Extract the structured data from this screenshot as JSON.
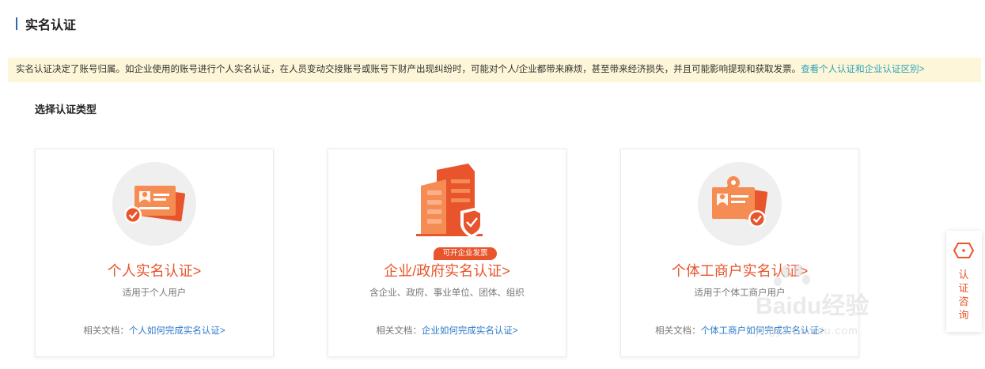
{
  "header": {
    "title": "实名认证"
  },
  "notice": {
    "text": "实名认证决定了账号归属。如企业使用的账号进行个人实名认证，在人员变动交接账号或账号下财产出现纠纷时，可能对个人/企业都带来麻烦，甚至带来经济损失，并且可能影响提现和获取发票。",
    "link": "查看个人认证和企业认证区别>"
  },
  "section": {
    "title": "选择认证类型"
  },
  "cards": [
    {
      "title": "个人实名认证>",
      "desc": "适用于个人用户",
      "doc_label": "相关文档：",
      "doc_link": "个人如何完成实名认证>",
      "icon": "id-card-icon"
    },
    {
      "title": "企业/政府实名认证>",
      "desc": "含企业、政府、事业单位、团体、组织",
      "doc_label": "相关文档：",
      "doc_link": "企业如何完成实名认证>",
      "badge": "可开企业发票",
      "icon": "building-icon"
    },
    {
      "title": "个体工商户实名认证>",
      "desc": "适用于个体工商户用户",
      "doc_label": "相关文档：",
      "doc_link": "个体工商户如何完成实名认证>",
      "icon": "merchant-icon"
    }
  ],
  "consult": {
    "label": "认证咨询",
    "icon": "consult-icon"
  },
  "watermark": {
    "brand": "Baidu经验",
    "url": "jingyan.baidu.com"
  },
  "colors": {
    "accent": "#e8542b",
    "link": "#2a79c9",
    "notice_bg": "#fdf6d8",
    "notice_link": "#2ea3b8"
  }
}
